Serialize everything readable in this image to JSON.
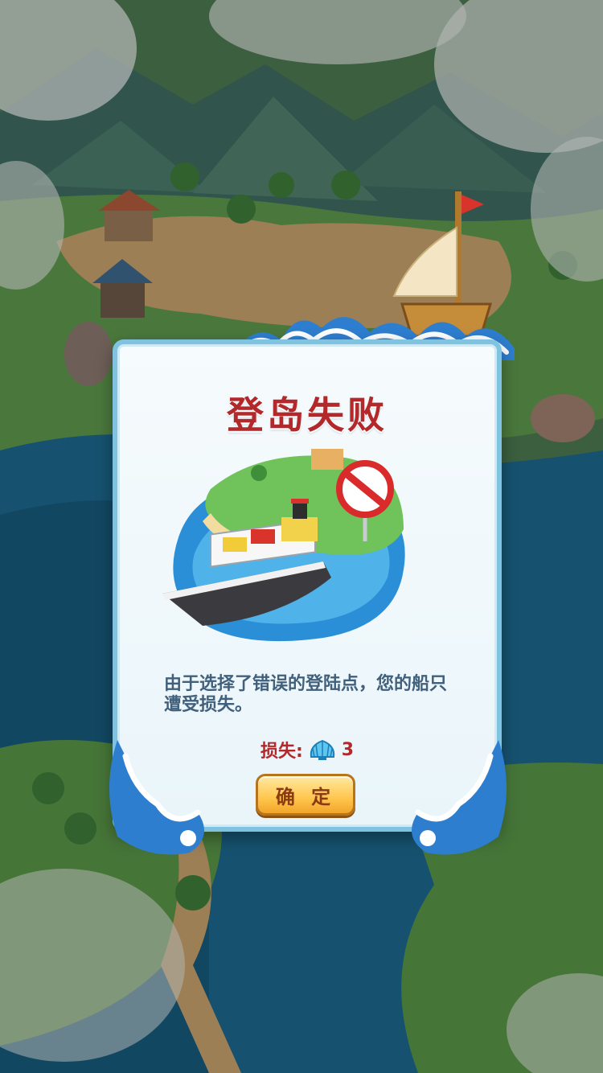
{
  "dialog": {
    "title": "登岛失败",
    "message": "由于选择了错误的登陆点，您的船只遭受损失。",
    "loss_label": "损失:",
    "loss_value": "3",
    "confirm_label": "确 定"
  },
  "icons": {
    "loss_currency": "shell-icon",
    "prohibited": "no-entry-sign-icon"
  },
  "colors": {
    "title_red": "#b3282a",
    "message_blue": "#41607c",
    "button_gold": "#ffc64d",
    "dialog_border": "#7fc3e0"
  }
}
